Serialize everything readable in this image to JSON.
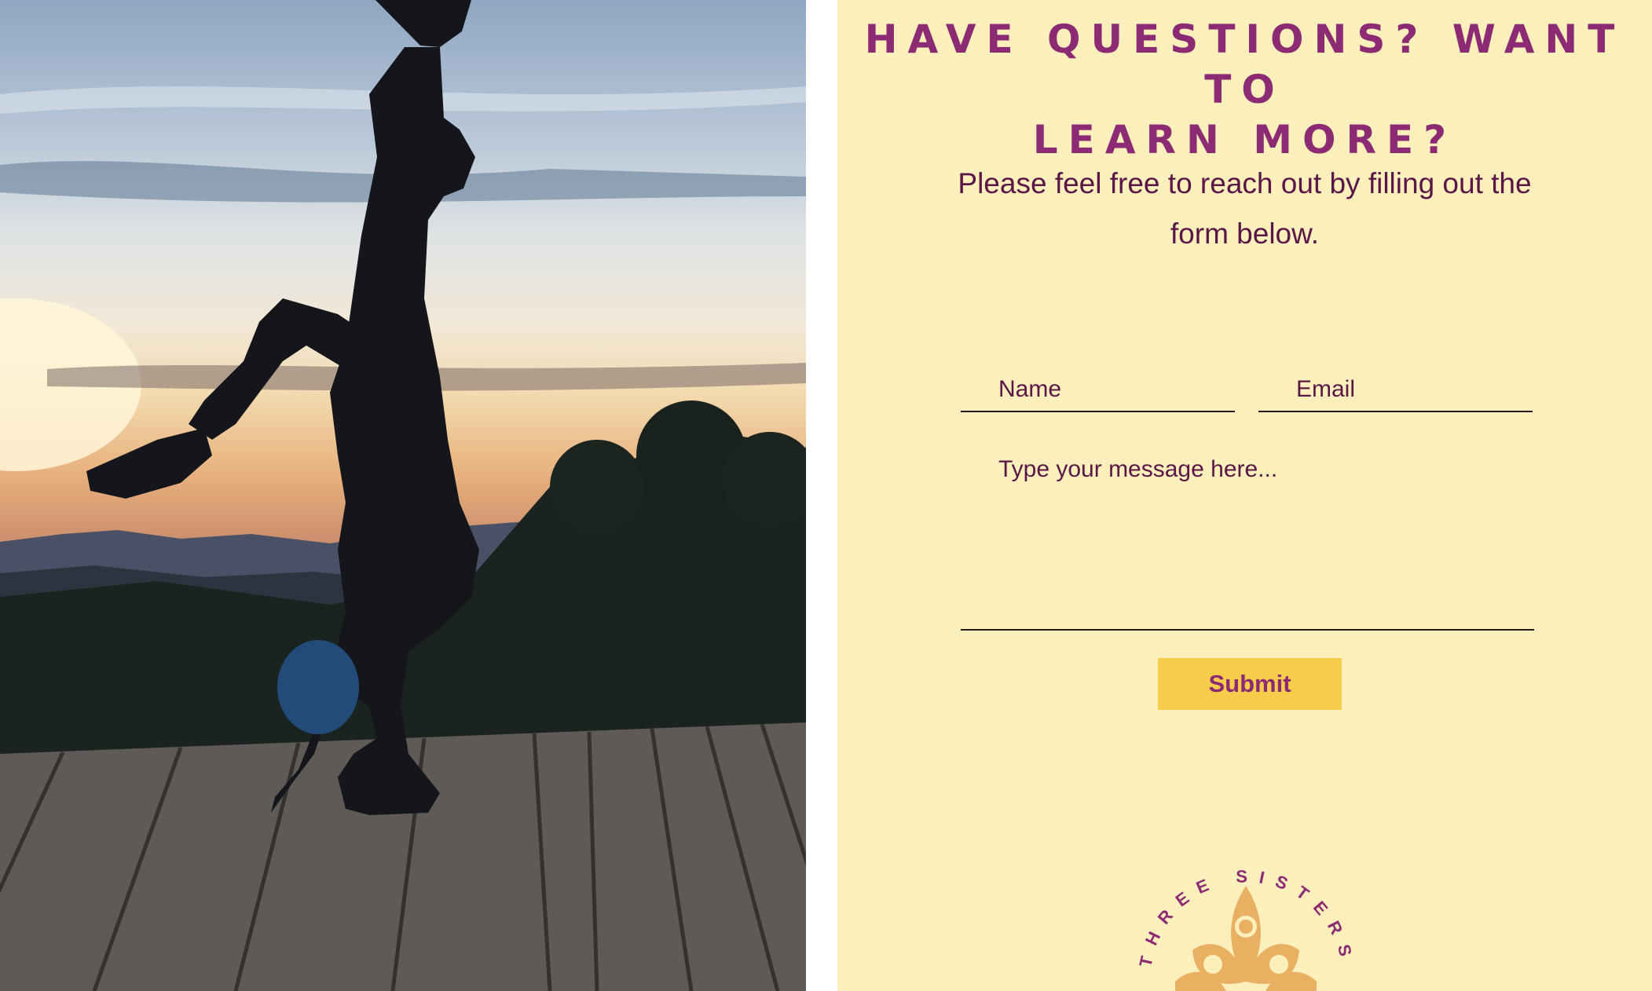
{
  "heading": {
    "line1": "Have Questions?  Want to",
    "line2": "learn more?"
  },
  "intro": {
    "text": "Please feel free to reach out by filling out the form below."
  },
  "form": {
    "name_placeholder": "Name",
    "email_placeholder": "Email",
    "message_placeholder": "Type your message here...",
    "submit_label": "Submit"
  },
  "logo": {
    "text": "THREE SISTERS"
  },
  "colors": {
    "panel_background": "#fbefbc",
    "heading": "#8c2a74",
    "body_text": "#5a1646",
    "button": "#f6cd4b",
    "logo_mark": "#e9b062"
  }
}
